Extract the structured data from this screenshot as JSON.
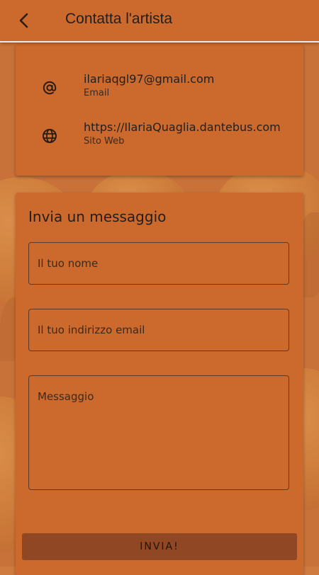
{
  "header": {
    "title": "Contatta l'artista",
    "back_icon": "back-arrow-icon"
  },
  "contact": {
    "items": [
      {
        "icon": "at-sign-icon",
        "value": "ilariaqgl97@gmail.com",
        "label": "Email"
      },
      {
        "icon": "globe-icon",
        "value": "https://IlariaQuaglia.dantebus.com",
        "label": "Sito Web"
      }
    ]
  },
  "form": {
    "title": "Invia un messaggio",
    "name_placeholder": "Il tuo nome",
    "email_placeholder": "Il tuo indirizzo email",
    "message_placeholder": "Messaggio",
    "submit_label": "INVIA!"
  },
  "colors": {
    "accent": "#cc6a2e",
    "button": "#8f4823"
  }
}
